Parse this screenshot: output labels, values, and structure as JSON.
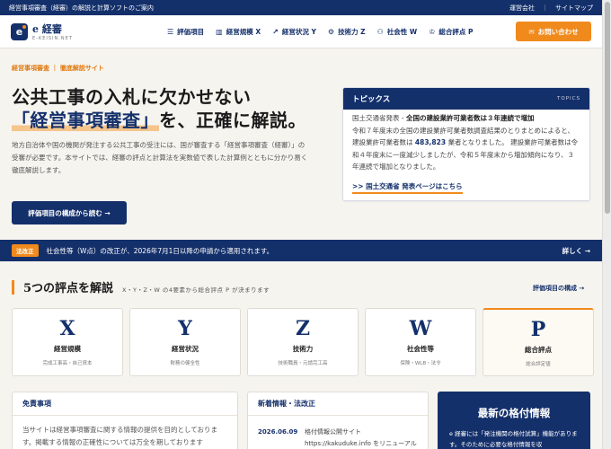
{
  "topbar": {
    "tagline": "経営事項審査（経審）の解説と計算ソフトのご案内",
    "links": [
      "運営会社",
      "サイトマップ"
    ],
    "separator": "｜"
  },
  "header": {
    "logo_mark": "e",
    "logo_title": "e 経審",
    "logo_sub": "E-KEISIN.NET",
    "nav": [
      {
        "icon": "☰",
        "label": "評価項目"
      },
      {
        "icon": "▥",
        "label": "経営規模 X"
      },
      {
        "icon": "↗",
        "label": "経営状況 Y"
      },
      {
        "icon": "⚙",
        "label": "技術力 Z"
      },
      {
        "icon": "⚇",
        "label": "社会性 W"
      },
      {
        "icon": "♔",
        "label": "総合評点 P"
      }
    ],
    "contact_icon": "✉",
    "contact_label": "お問い合わせ"
  },
  "hero": {
    "label": "経営事項審査 ｜ 徹底解説サイト",
    "title_line1": "公共工事の入札に欠かせない",
    "title_highlight": "「経営事項審査」",
    "title_line2_rest": "を、正確に解説。",
    "desc": "地方自治体や国の機関が発注する公共工事の受注には、国が審査する「経営事項審査（経審）」の受審が必要です。本サイトでは、経審の評点と計算法を実数値で表した計算例とともに分かり易く徹底解説します。",
    "button": "評価項目の構成から読む →"
  },
  "topics": {
    "title": "トピックス",
    "title_en": "TOPICS",
    "line_prefix": "国土交通省発表 - ",
    "headline": "全国の建設業許可業者数は３年連続で増加",
    "body_1": "令和７年度末の全国の建設業許可業者数調査結果のとりまとめによると、建設業許可業者数は ",
    "count": "483,823",
    "body_2": " 業者となりました。 建設業許可業者数は令和４年度末に一度減少しましたが、令和５年度末から増加傾向になり、３年連続で増加となりました。",
    "link": ">> 国土交通省 発表ページはこちら"
  },
  "notice": {
    "badge": "法改正",
    "text": "社会性等（W点）の改正が、2026年7月1日以降の申請から適用されます。",
    "more": "詳しく →"
  },
  "scores_section": {
    "title": "5つの評点を解説",
    "subtitle": "X・Y・Z・W の4要素から総合評点 P が決まります",
    "link": "評価項目の構成 →",
    "cards": [
      {
        "letter": "X",
        "name": "経営規模",
        "desc": "完成工事高・自己資本"
      },
      {
        "letter": "Y",
        "name": "経営状況",
        "desc": "財務の健全性"
      },
      {
        "letter": "Z",
        "name": "技術力",
        "desc": "技術職員・元請完工高"
      },
      {
        "letter": "W",
        "name": "社会性等",
        "desc": "保険・WLB・法令"
      },
      {
        "letter": "P",
        "name": "総合評点",
        "desc": "総合評定値"
      }
    ]
  },
  "disclaimer": {
    "title": "免責事項",
    "body": "当サイトは経営事項審査に関する情報の提供を目的としております。掲載する情報の正確性については万全を期しております"
  },
  "news": {
    "title": "新着情報・法改正",
    "date": "2026.06.09",
    "text": "格付情報公開サイト https://kakuduke.info をリニューアル"
  },
  "promo": {
    "title": "最新の格付情報",
    "body": "e 経審には「発注機関の格付試算」機能があります。そのために必要な格付情報を収"
  }
}
